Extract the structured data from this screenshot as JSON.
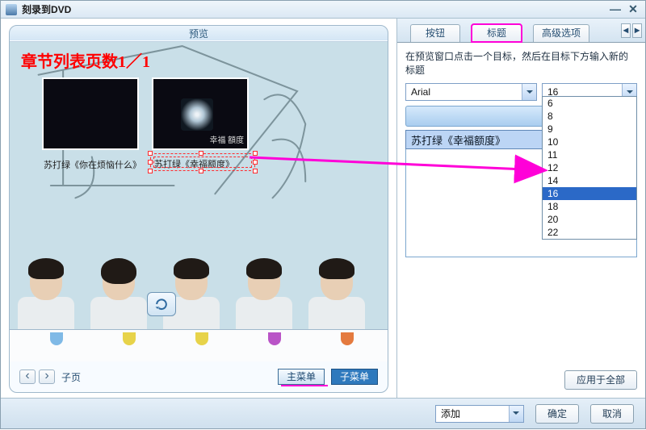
{
  "window": {
    "title": "刻录到DVD"
  },
  "preview": {
    "header": "预览",
    "overlay": "章节列表页数1／1",
    "thumb2_text": "幸福\n額度",
    "caption1": "苏打绿《你在烦恼什么》",
    "caption2": "苏打绿《幸福额度》",
    "back_icon": "undo-icon",
    "pager": {
      "prev": "‹",
      "next": "›",
      "label": "子页"
    },
    "menu_tabs": {
      "main": "主菜单",
      "sub": "子菜单"
    }
  },
  "right": {
    "tabs": {
      "buttons": "按钮",
      "title": "标题",
      "advanced": "高级选项"
    },
    "hint": "在预览窗口点击一个目标，然后在目标下方输入新的标题",
    "font": "Arial",
    "size": "16",
    "title_value": "苏打绿《幸福额度》",
    "sizes": [
      "6",
      "8",
      "9",
      "10",
      "11",
      "12",
      "14",
      "16",
      "18",
      "20",
      "22"
    ],
    "size_selected": "16",
    "apply_all": "应用于全部"
  },
  "bottom": {
    "add": "添加",
    "ok": "确定",
    "cancel": "取消"
  }
}
